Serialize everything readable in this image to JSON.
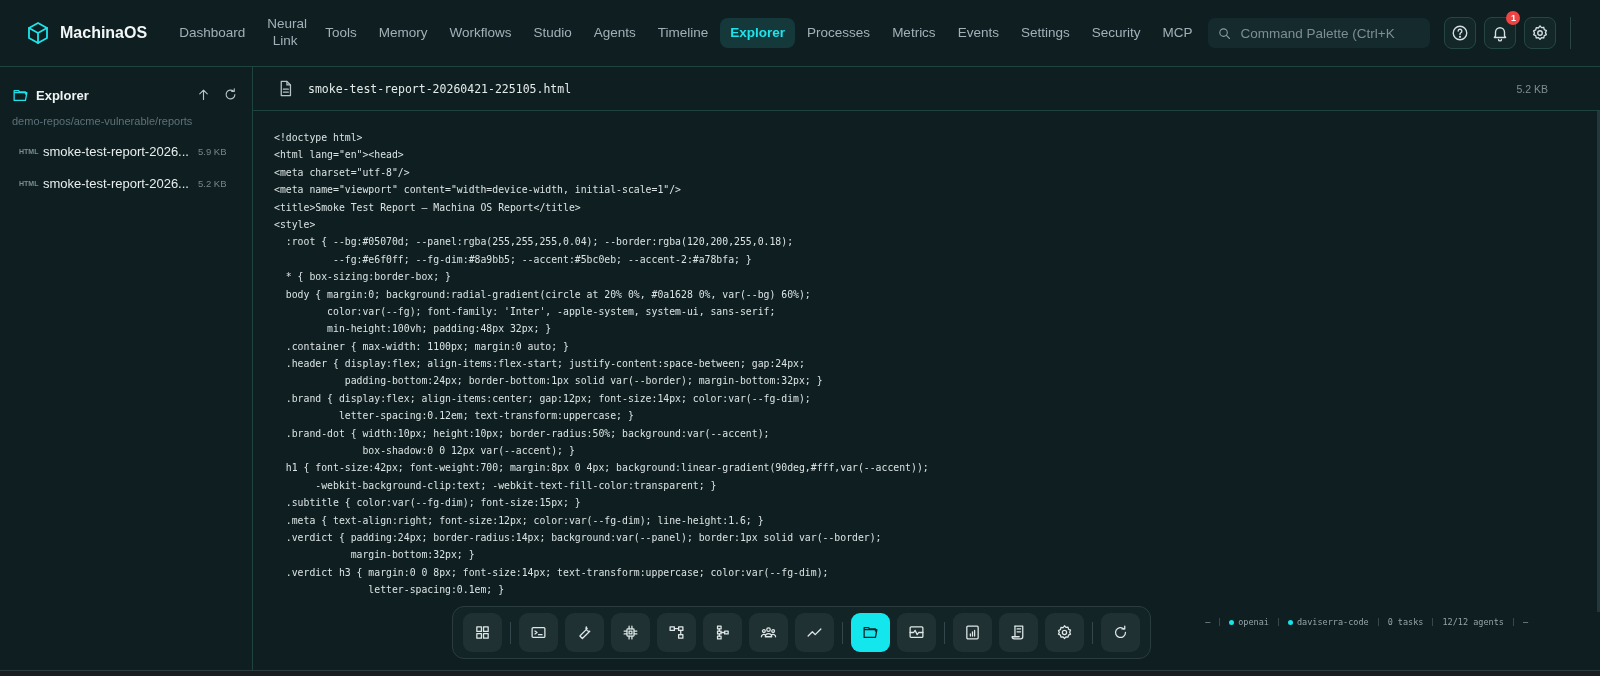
{
  "brand": {
    "name": "MachinaOS"
  },
  "nav": [
    {
      "label": "Dashboard",
      "selected": false
    },
    {
      "label": "Neural Link",
      "selected": false
    },
    {
      "label": "Tools",
      "selected": false
    },
    {
      "label": "Memory",
      "selected": false
    },
    {
      "label": "Workflows",
      "selected": false
    },
    {
      "label": "Studio",
      "selected": false
    },
    {
      "label": "Agents",
      "selected": false
    },
    {
      "label": "Timeline",
      "selected": false
    },
    {
      "label": "Explorer",
      "selected": true
    },
    {
      "label": "Processes",
      "selected": false
    },
    {
      "label": "Metrics",
      "selected": false
    },
    {
      "label": "Events",
      "selected": false
    },
    {
      "label": "Settings",
      "selected": false
    },
    {
      "label": "Security",
      "selected": false
    },
    {
      "label": "MCP",
      "selected": false
    }
  ],
  "search": {
    "placeholder": "Command Palette (Ctrl+K"
  },
  "notification_badge": "1",
  "sidebar": {
    "title": "Explorer",
    "path": "demo-repos/acme-vulnerable/reports",
    "files": [
      {
        "type": "HTML",
        "name": "smoke-test-report-2026...",
        "size": "5.9 KB"
      },
      {
        "type": "HTML",
        "name": "smoke-test-report-2026...",
        "size": "5.2 KB"
      }
    ]
  },
  "viewer": {
    "filename": "smoke-test-report-20260421-225105.html",
    "size": "5.2 KB",
    "lines": [
      "<!doctype html>",
      "<html lang=\"en\"><head>",
      "<meta charset=\"utf-8\"/>",
      "<meta name=\"viewport\" content=\"width=device-width, initial-scale=1\"/>",
      "<title>Smoke Test Report — Machina OS Report</title>",
      "<style>",
      "  :root { --bg:#05070d; --panel:rgba(255,255,255,0.04); --border:rgba(120,200,255,0.18);",
      "          --fg:#e6f0ff; --fg-dim:#8a9bb5; --accent:#5bc0eb; --accent-2:#a78bfa; }",
      "  * { box-sizing:border-box; }",
      "  body { margin:0; background:radial-gradient(circle at 20% 0%, #0a1628 0%, var(--bg) 60%);",
      "         color:var(--fg); font-family: 'Inter', -apple-system, system-ui, sans-serif;",
      "         min-height:100vh; padding:48px 32px; }",
      "  .container { max-width: 1100px; margin:0 auto; }",
      "  .header { display:flex; align-items:flex-start; justify-content:space-between; gap:24px;",
      "            padding-bottom:24px; border-bottom:1px solid var(--border); margin-bottom:32px; }",
      "  .brand { display:flex; align-items:center; gap:12px; font-size:14px; color:var(--fg-dim);",
      "           letter-spacing:0.12em; text-transform:uppercase; }",
      "  .brand-dot { width:10px; height:10px; border-radius:50%; background:var(--accent);",
      "               box-shadow:0 0 12px var(--accent); }",
      "  h1 { font-size:42px; font-weight:700; margin:8px 0 4px; background:linear-gradient(90deg,#fff,var(--accent));",
      "       -webkit-background-clip:text; -webkit-text-fill-color:transparent; }",
      "  .subtitle { color:var(--fg-dim); font-size:15px; }",
      "  .meta { text-align:right; font-size:12px; color:var(--fg-dim); line-height:1.6; }",
      "  .verdict { padding:24px; border-radius:14px; background:var(--panel); border:1px solid var(--border);",
      "             margin-bottom:32px; }",
      "  .verdict h3 { margin:0 0 8px; font-size:14px; text-transform:uppercase; color:var(--fg-dim);",
      "                letter-spacing:0.1em; }"
    ]
  },
  "status_bar": [
    {
      "kind": "text",
      "text": "—"
    },
    {
      "kind": "dot",
      "text": "openai"
    },
    {
      "kind": "dot",
      "text": "daviserra-code"
    },
    {
      "kind": "text",
      "text": "0 tasks"
    },
    {
      "kind": "text",
      "text": "12/12 agents"
    },
    {
      "kind": "text",
      "text": "—"
    }
  ],
  "dock": [
    [
      {
        "selected": false
      }
    ],
    [
      {
        "selected": false
      },
      {
        "selected": false
      },
      {
        "selected": false
      },
      {
        "selected": false
      },
      {
        "selected": false
      },
      {
        "selected": false
      },
      {
        "selected": false
      }
    ],
    [
      {
        "selected": true
      },
      {
        "selected": false
      }
    ],
    [
      {
        "selected": false
      },
      {
        "selected": false
      },
      {
        "selected": false
      }
    ],
    [
      {
        "selected": false
      }
    ]
  ]
}
